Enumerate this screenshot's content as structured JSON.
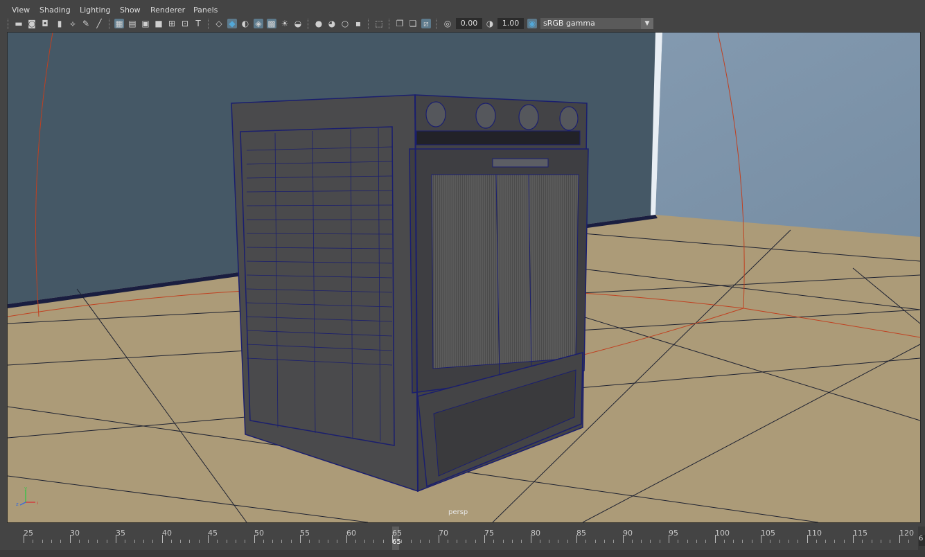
{
  "menu": [
    "View",
    "Shading",
    "Lighting",
    "Show",
    "Renderer",
    "Panels"
  ],
  "toolbar": {
    "exposure": "0.00",
    "gamma_value": "1.00",
    "color_space": "sRGB gamma",
    "icons": [
      "select-camera-icon",
      "camera-attributes-icon",
      "bookmarks-icon",
      "image-plane-icon",
      "2d-pan-zoom-icon",
      "grease-pencil-icon",
      "grid-icon",
      "film-gate-icon",
      "resolution-gate-icon",
      "gate-mask-icon",
      "field-chart-icon",
      "safe-action-icon",
      "safe-title-icon",
      "wireframe-icon",
      "smooth-shade-icon",
      "use-default-material-icon",
      "wireframe-on-shaded-icon",
      "xray-icon",
      "use-all-lights-icon",
      "shadows-icon",
      "screen-space-ao-icon",
      "motion-blur-icon",
      "multisample-aa-icon",
      "depth-of-field-icon",
      "isolate-select-icon",
      "xray-joints-icon",
      "xray-active-icon",
      "backface-culling-icon",
      "exposure-icon",
      "gamma-icon",
      "color-management-icon"
    ]
  },
  "viewport": {
    "camera": "persp",
    "axis": {
      "y": "y",
      "x": "x",
      "z": "z"
    }
  },
  "timeline": {
    "ticks": [
      "25",
      "30",
      "35",
      "40",
      "45",
      "50",
      "55",
      "60",
      "65",
      "70",
      "75",
      "80",
      "85",
      "90",
      "95",
      "100",
      "105",
      "110",
      "115",
      "120"
    ],
    "current_frame": "65",
    "right_field": "6"
  },
  "colors": {
    "wall_left": "#455866",
    "wall_right": "#8ea5bb",
    "floor": "#ac9b78",
    "wire": "#1a1e6e",
    "accent": "#52a8d8"
  }
}
